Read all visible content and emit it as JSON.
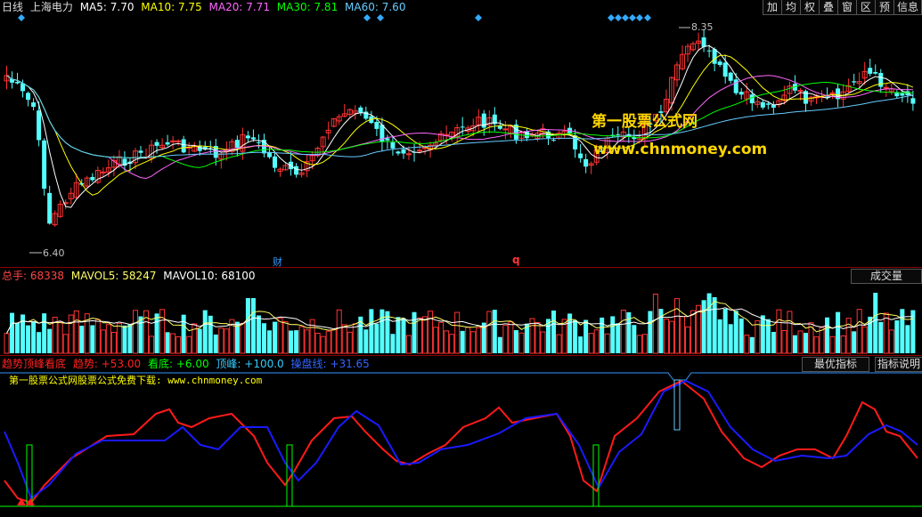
{
  "header": {
    "period": "日线",
    "stock_name": "上海电力",
    "ma": [
      {
        "label": "MA5: 7.70",
        "color": "#ffffff"
      },
      {
        "label": "MA10: 7.75",
        "color": "#ffff00"
      },
      {
        "label": "MA20: 7.71",
        "color": "#ff66ff"
      },
      {
        "label": "MA30: 7.81",
        "color": "#00ff00"
      },
      {
        "label": "MA60: 7.60",
        "color": "#66ccff"
      }
    ]
  },
  "toolbar": [
    "加",
    "均",
    "权",
    "叠",
    "窗",
    "区",
    "预",
    "信息"
  ],
  "price_panel": {
    "high_label": "8.35",
    "low_label": "6.40",
    "marker_cai": "财",
    "marker_q": "q",
    "watermark_title": "第一股票公式网",
    "watermark_url": "www.chnmoney.com"
  },
  "volume_panel": {
    "legend": [
      {
        "label": "总手: 68338",
        "color": "#ff4444"
      },
      {
        "label": "MAVOL5: 58247",
        "color": "#ffff66"
      },
      {
        "label": "MAVOL10: 68100",
        "color": "#ffffff"
      }
    ],
    "button": "成交量"
  },
  "indicator_panel": {
    "legend": [
      {
        "label": "趋势顶峰看底",
        "color": "#ff2020"
      },
      {
        "label": "趋势: +53.00",
        "color": "#ff2020"
      },
      {
        "label": "看底: +6.00",
        "color": "#00ff00"
      },
      {
        "label": "顶峰: +100.0",
        "color": "#33ccff"
      },
      {
        "label": "操盘线: +31.65",
        "color": "#3366ff"
      }
    ],
    "btn_best": "最优指标",
    "btn_help": "指标说明",
    "note": "第一股票公式网股票公式免费下载: www.chnmoney.com"
  },
  "colors": {
    "up": "#ff3333",
    "down": "#54ffff",
    "divider": "#8b0000",
    "trend": "#ff1a1a",
    "control": "#1a1aff",
    "signal": "#00ff00"
  }
}
